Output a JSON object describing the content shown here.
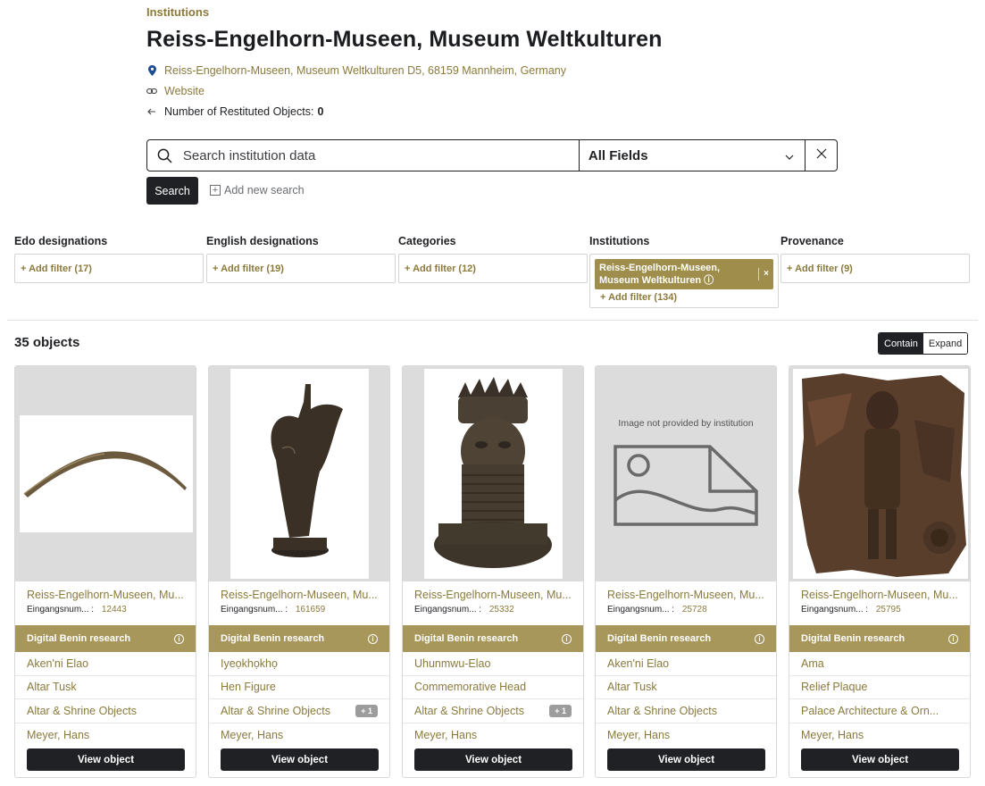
{
  "breadcrumb": "Institutions",
  "title": "Reiss-Engelhorn-Museen, Museum Weltkulturen",
  "address": "Reiss-Engelhorn-Museen, Museum Weltkulturen D5, 68159 Mannheim, Germany",
  "website_label": "Website",
  "restituted_label": "Number of Restituted Objects:",
  "restituted_value": "0",
  "search": {
    "placeholder": "Search institution data",
    "field": "All Fields",
    "button_label": "Search",
    "add_label": "Add new search"
  },
  "filters": [
    {
      "title": "Edo designations",
      "add_label": "+ Add filter (17)"
    },
    {
      "title": "English designations",
      "add_label": "+ Add filter (19)"
    },
    {
      "title": "Categories",
      "add_label": "+ Add filter (12)"
    },
    {
      "title": "Institutions",
      "chip": "Reiss-Engelhorn-Museen, Museum Weltkulturen ⓘ",
      "add_label": "+ Add filter (134)"
    },
    {
      "title": "Provenance",
      "add_label": "+ Add filter (9)"
    }
  ],
  "results_count": "35 objects",
  "view_toggle": {
    "contain": "Contain",
    "expand": "Expand"
  },
  "cards": [
    {
      "institution": "Reiss-Engelhorn-Museen, Mu...",
      "inv_label": "Eingangsnum...",
      "inv_value": "12443",
      "research": "Digital Benin research",
      "edo": "Aken'ni Elao",
      "english": "Altar Tusk",
      "category": "Altar & Shrine Objects",
      "category_extra": "",
      "provenance": "Meyer, Hans",
      "button": "View object"
    },
    {
      "institution": "Reiss-Engelhorn-Museen, Mu...",
      "inv_label": "Eingangsnum...",
      "inv_value": "161659",
      "research": "Digital Benin research",
      "edo": "Iyeọkhọkhọ",
      "english": "Hen Figure",
      "category": "Altar & Shrine Objects",
      "category_extra": "+ 1",
      "provenance": "Meyer, Hans",
      "button": "View object"
    },
    {
      "institution": "Reiss-Engelhorn-Museen, Mu...",
      "inv_label": "Eingangsnum...",
      "inv_value": "25332",
      "research": "Digital Benin research",
      "edo": "Uhunmwu-Elao",
      "english": "Commemorative Head",
      "category": "Altar & Shrine Objects",
      "category_extra": "+ 1",
      "provenance": "Meyer, Hans",
      "button": "View object"
    },
    {
      "institution": "Reiss-Engelhorn-Museen, Mu...",
      "inv_label": "Eingangsnum...",
      "inv_value": "25728",
      "research": "Digital Benin research",
      "edo": "Aken'ni Elao",
      "english": "Altar Tusk",
      "category": "Altar & Shrine Objects",
      "category_extra": "",
      "provenance": "Meyer, Hans",
      "button": "View object",
      "no_image_text": "Image not provided by institution"
    },
    {
      "institution": "Reiss-Engelhorn-Museen, Mu...",
      "inv_label": "Eingangsnum...",
      "inv_value": "25795",
      "research": "Digital Benin research",
      "edo": "Ama",
      "english": "Relief Plaque",
      "category": "Palace Architecture & Orn...",
      "category_extra": "",
      "provenance": "Meyer, Hans",
      "button": "View object"
    }
  ],
  "colors": {
    "accent": "#8a7a3c",
    "research_bar": "#a8975a",
    "dark": "#1f2124"
  },
  "icons": {
    "location": "map-pin-icon",
    "link": "link-icon",
    "restituted": "arrow-left-icon",
    "search": "search-icon",
    "dropdown": "chevron-down-icon",
    "clear": "close-icon",
    "add": "plus-square-icon",
    "info": "info-icon"
  }
}
